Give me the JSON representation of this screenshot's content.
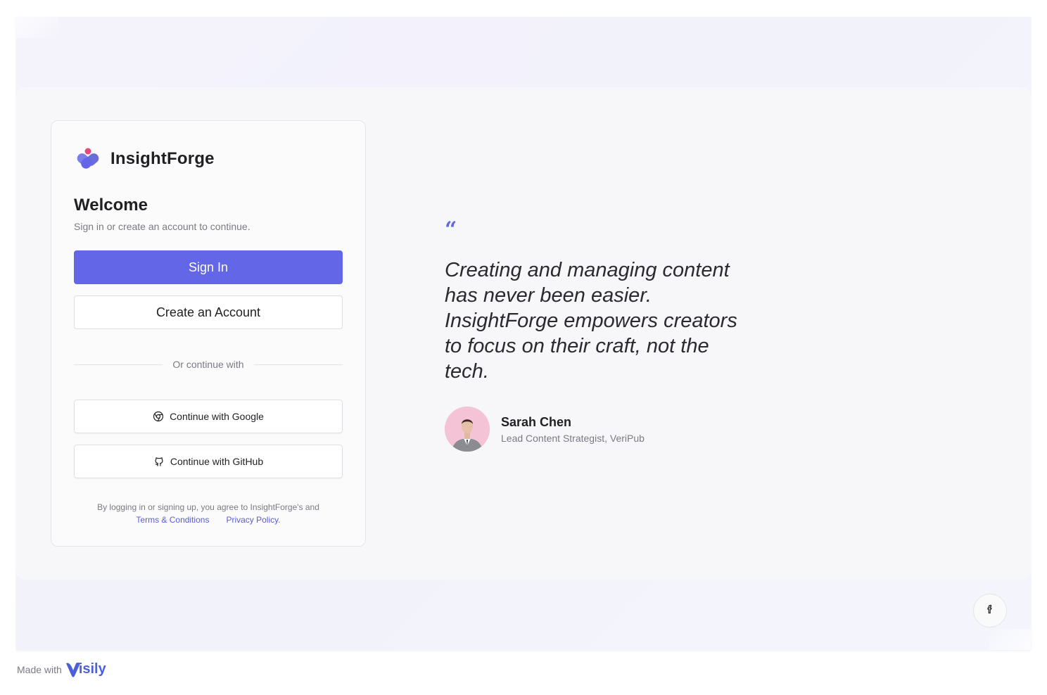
{
  "brand": {
    "name": "InsightForge",
    "accent": "#6366e6"
  },
  "auth": {
    "title": "Welcome",
    "subtitle": "Sign in or create an account to continue.",
    "sign_in_label": "Sign In",
    "create_account_label": "Create an Account",
    "divider_label": "Or continue with",
    "google_label": "Continue with Google",
    "github_label": "Continue with GitHub",
    "legal_prefix": "By logging in or signing up, you agree to InsightForge's and",
    "terms_label": "Terms & Conditions",
    "privacy_label": "Privacy Policy",
    "legal_suffix": "."
  },
  "testimonial": {
    "quote_mark": "“",
    "quote": "Creating and managing content has never been easier. InsightForge empowers creators to focus on their craft, not the tech.",
    "author_name": "Sarah Chen",
    "author_role": "Lead Content Strategist, VeriPub"
  },
  "footer": {
    "made_with": "Made with",
    "visily_label": "isily"
  },
  "icons": {
    "google": "chrome-icon",
    "github": "github-icon",
    "facebook": "facebook-icon"
  }
}
